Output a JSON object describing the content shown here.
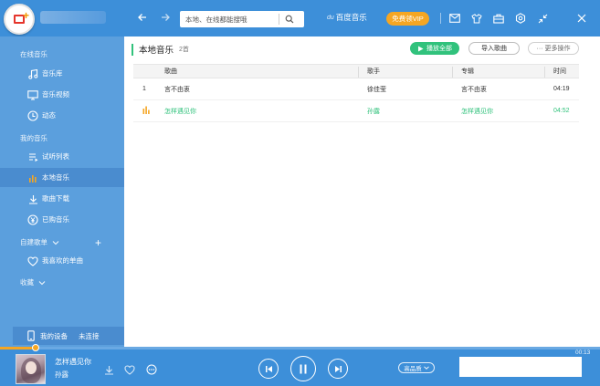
{
  "header": {
    "search_placeholder": "本地、在线都能搜哦",
    "brand": "百度音乐",
    "brand_logo": "du",
    "vip_label": "免费领VIP"
  },
  "sidebar": {
    "section_online": "在线音乐",
    "online_items": [
      {
        "label": "音乐库",
        "icon": "music-note-icon"
      },
      {
        "label": "音乐视频",
        "icon": "tv-icon"
      },
      {
        "label": "动态",
        "icon": "dynamic-icon"
      }
    ],
    "section_my": "我的音乐",
    "my_items": [
      {
        "label": "试听列表",
        "icon": "playlist-icon"
      },
      {
        "label": "本地音乐",
        "icon": "bars-icon"
      },
      {
        "label": "歌曲下载",
        "icon": "download-icon"
      },
      {
        "label": "已购音乐",
        "icon": "yen-icon"
      }
    ],
    "section_custom": "自建歌单",
    "custom_items": [
      {
        "label": "我喜欢的单曲",
        "icon": "heart-icon"
      }
    ],
    "section_fav": "收藏",
    "device_label": "我的设备",
    "device_status": "未连接"
  },
  "main": {
    "title": "本地音乐",
    "count": "2首",
    "play_all": "播放全部",
    "import": "导入歌曲",
    "more_ops": "更多操作",
    "columns": {
      "name": "歌曲",
      "artist": "歌手",
      "album": "专辑",
      "time": "时间"
    },
    "rows": [
      {
        "index": "1",
        "name": "言不由衷",
        "artist": "徐佳莹",
        "album": "言不由衷",
        "time": "04:19",
        "playing": false
      },
      {
        "index": "",
        "name": "怎样遇见你",
        "artist": "孙露",
        "album": "怎样遇见你",
        "time": "04:52",
        "playing": true
      }
    ]
  },
  "player": {
    "title": "怎样遇见你",
    "artist": "孙露",
    "elapsed": "00:13",
    "progress": 0.06,
    "quality": "高品质"
  },
  "colors": {
    "topbar": "#3d8fd9",
    "sidebar": "#5b9fdd",
    "accent_green": "#31c27c",
    "vip_orange": "#f5a623"
  }
}
